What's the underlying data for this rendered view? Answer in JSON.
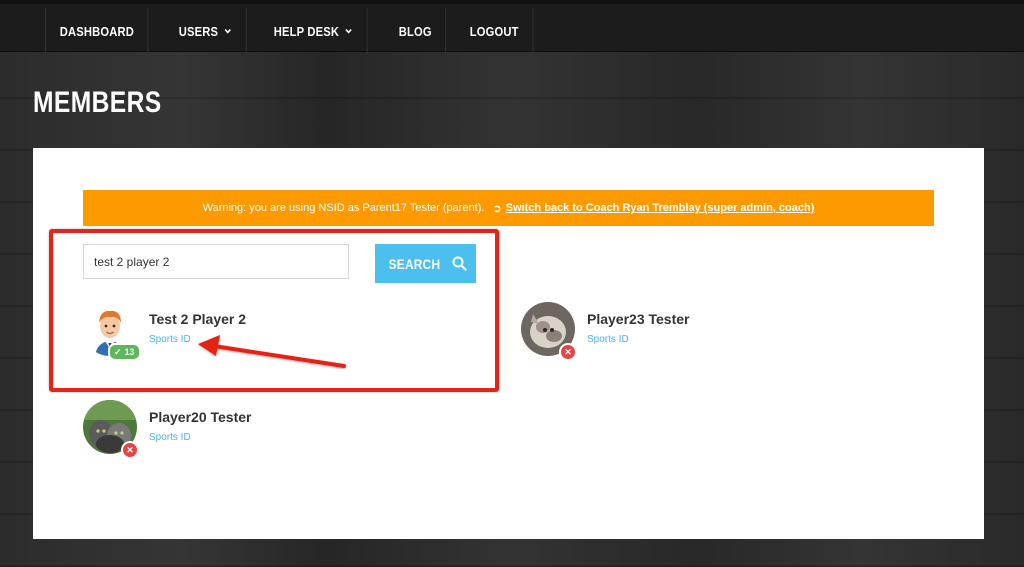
{
  "nav": {
    "items": [
      {
        "label": "DASHBOARD",
        "dropdown": false
      },
      {
        "label": "USERS",
        "dropdown": true
      },
      {
        "label": "HELP DESK",
        "dropdown": true
      },
      {
        "label": "BLOG",
        "dropdown": false
      },
      {
        "label": "LOGOUT",
        "dropdown": false
      }
    ]
  },
  "page": {
    "title": "MEMBERS"
  },
  "warning": {
    "text": "Warning: you are using NSID as Parent17 Tester (parent).",
    "icon": "switch-user-icon",
    "link_text": "Switch back to Coach Ryan Tremblay (super admin, coach)"
  },
  "search": {
    "value": "test 2 player 2",
    "button_label": "SEARCH",
    "button_icon": "search-icon"
  },
  "members": [
    {
      "name": "Test 2 Player 2",
      "link": "Sports ID",
      "status": "verified",
      "badge_count": "13"
    },
    {
      "name": "Player23 Tester",
      "link": "Sports ID",
      "status": "unverified"
    },
    {
      "name": "Player20 Tester",
      "link": "Sports ID",
      "status": "unverified"
    }
  ],
  "colors": {
    "warning_bg": "#fd9a00",
    "accent": "#4bc0ee",
    "link": "#4bb4e6",
    "annotation": "#e52317",
    "verified": "#5cb85c",
    "unverified": "#e64545"
  }
}
